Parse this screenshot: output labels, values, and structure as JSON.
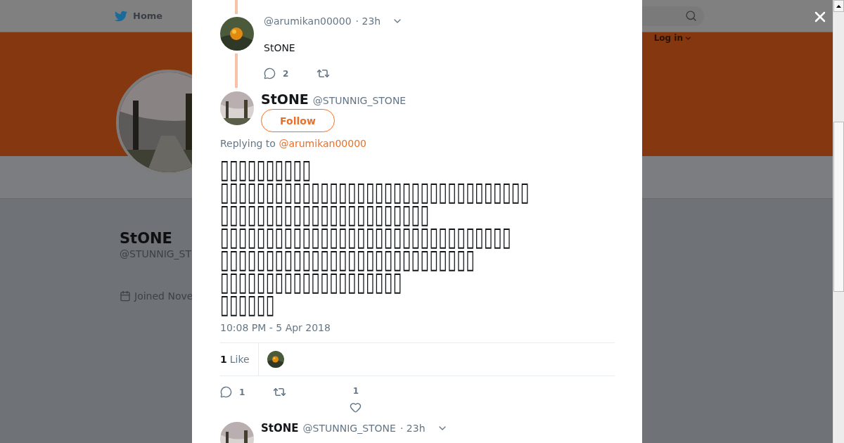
{
  "background": {
    "nav_home": "Home",
    "login": "Log in",
    "profile_name": "StONE",
    "profile_handle": "@STUNNIG_ST",
    "joined": "Joined Nove"
  },
  "parent_tweet": {
    "handle": "@arumikan00000",
    "time": "· 23h",
    "text": "StONE",
    "replies": "2"
  },
  "main_tweet": {
    "name": "StONE",
    "handle": "@STUNNIG_STONE",
    "follow": "Follow",
    "replying_label": "Replying to",
    "replying_to": "@arumikan00000",
    "text": "▯▯▯▯▯▯▯▯▯▯\n▯▯▯▯▯▯▯▯▯▯▯▯▯▯▯▯▯▯▯▯▯▯▯▯▯▯▯▯▯▯▯▯▯▯\n▯▯▯▯▯▯▯▯▯▯▯▯▯▯▯▯▯▯▯▯▯▯▯\n▯▯▯▯▯▯▯▯▯▯▯▯▯▯▯▯▯▯▯▯▯▯▯▯▯▯▯▯▯▯▯▯\n▯▯▯▯▯▯▯▯▯▯▯▯▯▯▯▯▯▯▯▯▯▯▯▯▯▯▯▯\n▯▯▯▯▯▯▯▯▯▯▯▯▯▯▯▯▯▯▯▯\n▯▯▯▯▯▯",
    "timestamp": "10:08 PM - 5 Apr 2018",
    "like_count": "1",
    "like_label": "Like",
    "replies": "1",
    "likes": "1"
  },
  "next_tweet": {
    "name": "StONE",
    "handle": "@STUNNIG_STONE",
    "time": "· 23h"
  }
}
